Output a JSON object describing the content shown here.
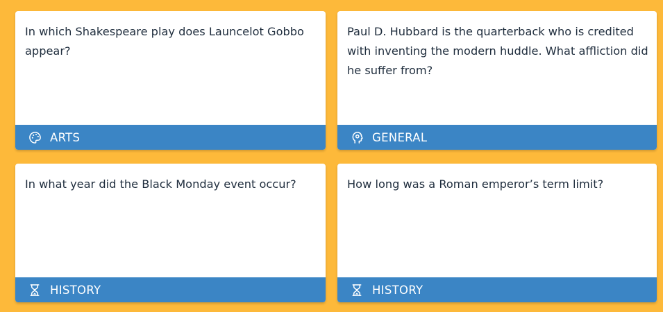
{
  "colors": {
    "background": "#FDB93A",
    "card": "#FFFFFF",
    "category_bar": "#3B85C5",
    "question_text": "#1F2D3D",
    "category_text": "#FFFFFF"
  },
  "cards": [
    {
      "question": "In which Shakespeare play does Launcelot Gobbo appear?",
      "category": "ARTS",
      "icon": "palette-icon"
    },
    {
      "question": "Paul D. Hubbard is the quarterback who is credited with inventing the modern huddle. What affliction did he suffer from?",
      "category": "GENERAL",
      "icon": "head-icon"
    },
    {
      "question": "In what year did the Black Monday event occur?",
      "category": "HISTORY",
      "icon": "hourglass-icon"
    },
    {
      "question": "How long was a Roman emperor’s term limit?",
      "category": "HISTORY",
      "icon": "hourglass-icon"
    }
  ]
}
